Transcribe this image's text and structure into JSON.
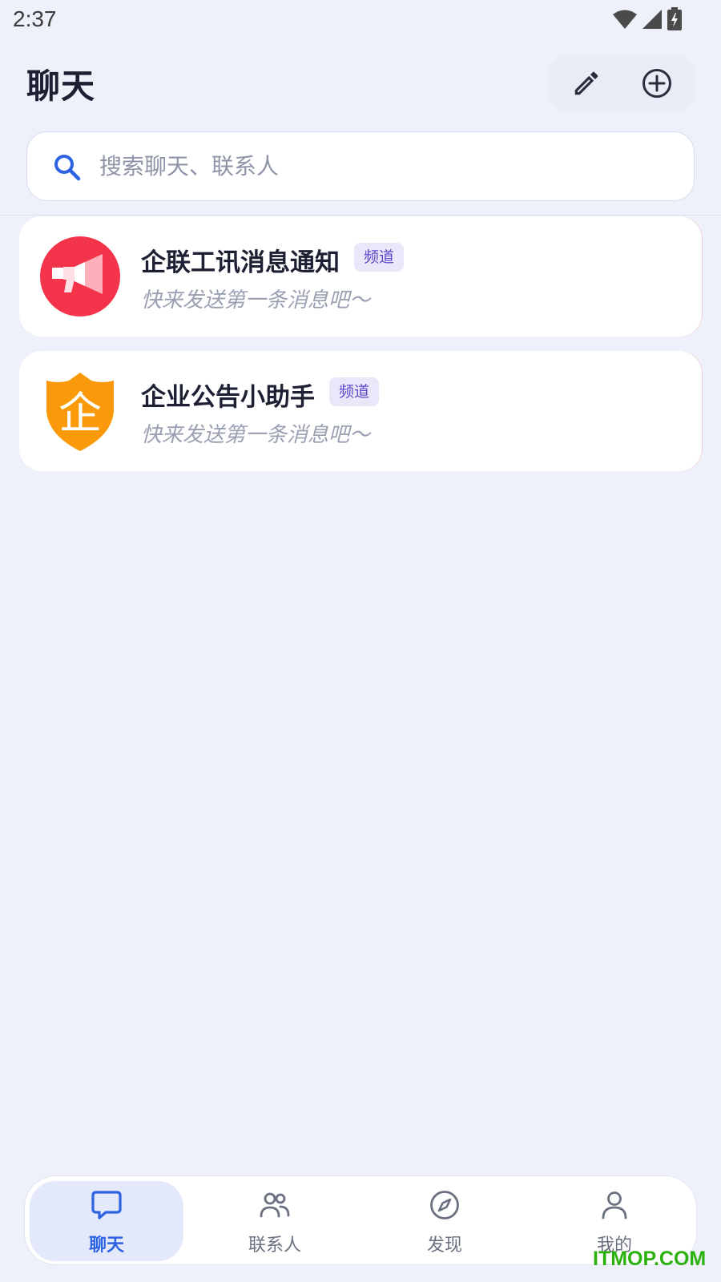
{
  "status_bar": {
    "time": "2:37"
  },
  "header": {
    "title": "聊天"
  },
  "search": {
    "placeholder": "搜索聊天、联系人"
  },
  "chats": [
    {
      "title": "企联工讯消息通知",
      "badge": "频道",
      "preview": "快来发送第一条消息吧〜",
      "avatar": "megaphone-icon",
      "avatar_color": "#f4344a"
    },
    {
      "title": "企业公告小助手",
      "badge": "频道",
      "preview": "快来发送第一条消息吧〜",
      "avatar": "shield-icon",
      "avatar_color": "#fa9a0a",
      "avatar_text": "企"
    }
  ],
  "nav": [
    {
      "label": "聊天",
      "icon": "chat-bubble-icon",
      "active": true
    },
    {
      "label": "联系人",
      "icon": "contacts-icon"
    },
    {
      "label": "发现",
      "icon": "compass-icon"
    },
    {
      "label": "我的",
      "icon": "person-icon"
    }
  ],
  "colors": {
    "accent": "#2d63e3",
    "background": "#eef1fa",
    "badge_text": "#5b48c9",
    "badge_bg": "#ebe7fb"
  },
  "watermark": "ITMOP.COM"
}
